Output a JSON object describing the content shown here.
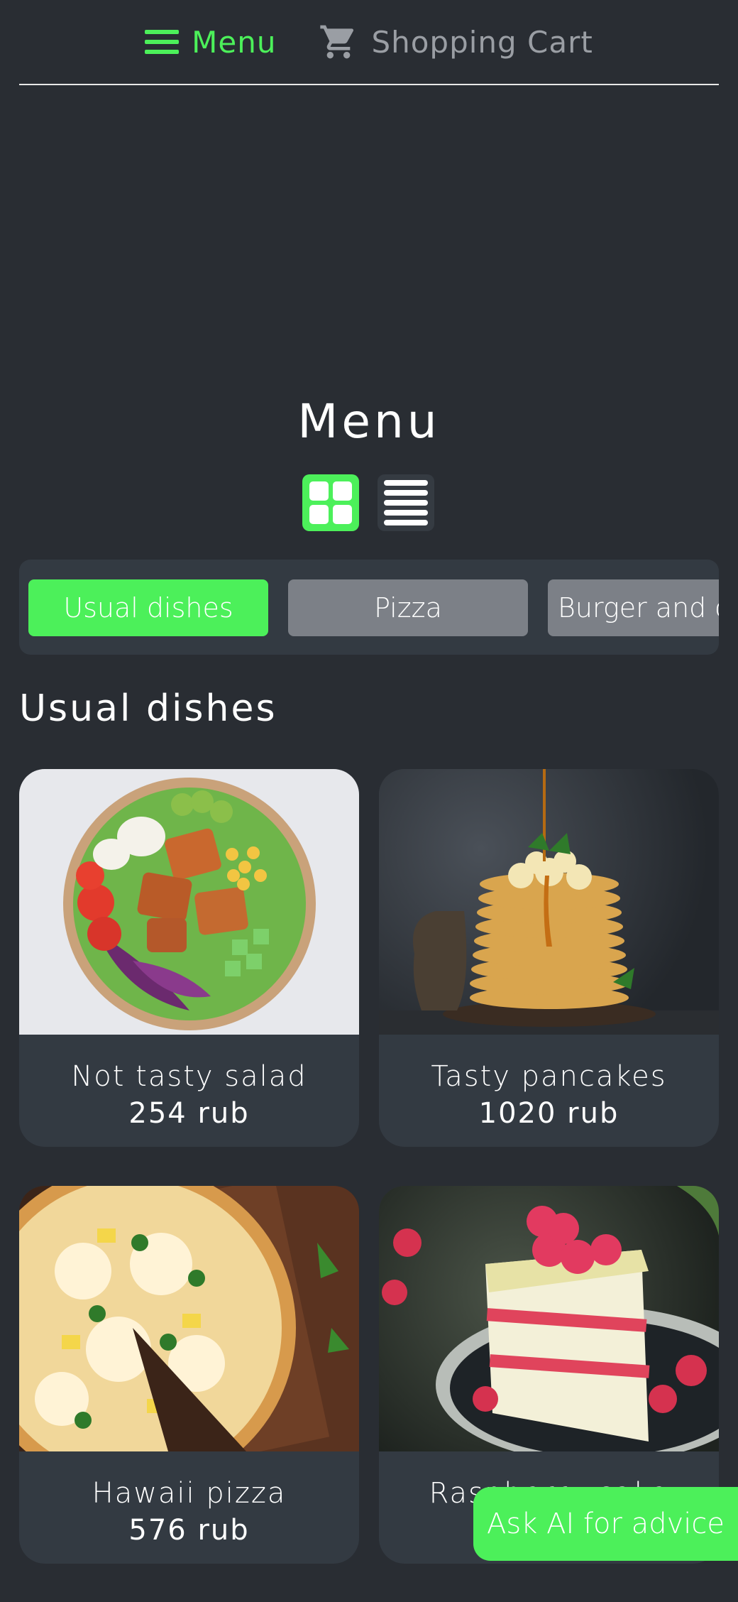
{
  "nav": {
    "menu_label": "Menu",
    "cart_label": "Shopping Cart"
  },
  "page_title": "Menu",
  "categories": [
    {
      "label": "Usual dishes",
      "active": true
    },
    {
      "label": "Pizza",
      "active": false
    },
    {
      "label": "Burger and c",
      "active": false
    }
  ],
  "section_title": "Usual dishes",
  "dishes": [
    {
      "name": "Not tasty salad",
      "price": "254 rub",
      "image": "salad-bowl-photo"
    },
    {
      "name": "Tasty pancakes",
      "price": "1020 rub",
      "image": "pancake-stack-photo"
    },
    {
      "name": "Hawaii pizza",
      "price": "576 rub",
      "image": "pizza-photo"
    },
    {
      "name": "Raspberry cake",
      "price": "",
      "image": "raspberry-cake-photo"
    }
  ],
  "ai_button_label": "Ask AI for advice",
  "colors": {
    "background": "#292d33",
    "accent": "#4cf05a",
    "card": "#333a42",
    "inactive_tab": "#7c8087"
  }
}
